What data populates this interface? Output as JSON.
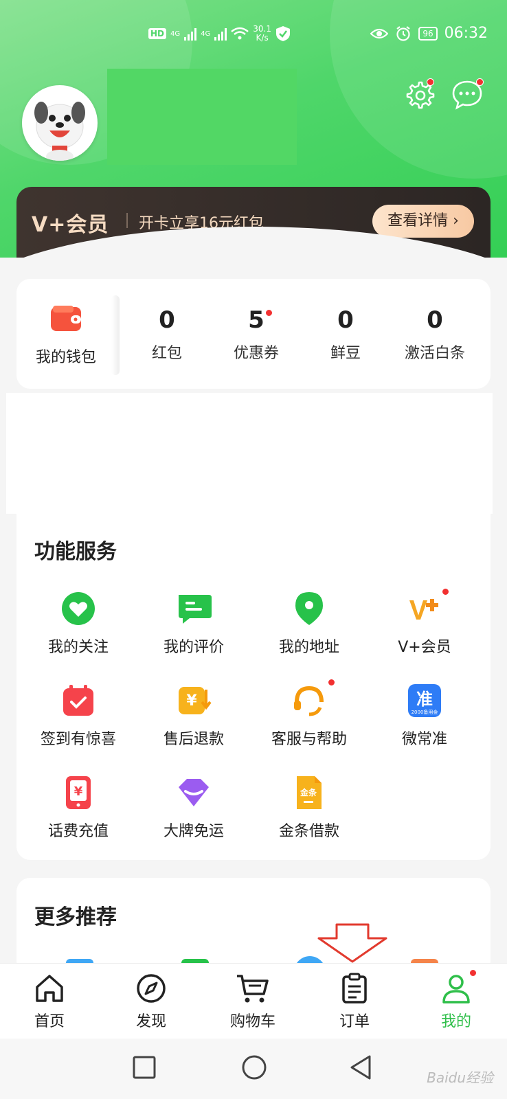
{
  "status_bar": {
    "hd": "HD",
    "network_1": "4G",
    "network_2": "4G",
    "speed_value": "30.1",
    "speed_unit": "K/s",
    "battery": "96",
    "time": "06:32"
  },
  "vip_banner": {
    "logo": "V+会员",
    "promo": "开卡立享16元红包",
    "button": "查看详情 ›"
  },
  "wallet": {
    "label": "我的钱包",
    "items": [
      {
        "value": "0",
        "label": "红包",
        "has_dot": false
      },
      {
        "value": "5",
        "label": "优惠券",
        "has_dot": true
      },
      {
        "value": "0",
        "label": "鲜豆",
        "has_dot": false
      },
      {
        "value": "0",
        "label": "激活白条",
        "has_dot": false
      }
    ]
  },
  "services": {
    "title": "功能服务",
    "items": [
      {
        "label": "我的关注",
        "icon": "heart-icon"
      },
      {
        "label": "我的评价",
        "icon": "comment-icon"
      },
      {
        "label": "我的地址",
        "icon": "location-pin-icon"
      },
      {
        "label": "V+会员",
        "icon": "vplus-icon"
      },
      {
        "label": "签到有惊喜",
        "icon": "calendar-check-icon"
      },
      {
        "label": "售后退款",
        "icon": "refund-icon"
      },
      {
        "label": "客服与帮助",
        "icon": "headset-icon"
      },
      {
        "label": "微常准",
        "icon": "weichangzhun-icon",
        "icon_text": "准",
        "icon_caption": "2000备用金"
      },
      {
        "label": "话费充值",
        "icon": "phone-recharge-icon"
      },
      {
        "label": "大牌免运",
        "icon": "diamond-box-icon"
      },
      {
        "label": "金条借款",
        "icon": "gold-bar-icon",
        "icon_text": "金条"
      }
    ]
  },
  "more": {
    "title": "更多推荐"
  },
  "bottom_nav": {
    "items": [
      {
        "label": "首页",
        "icon": "home-icon",
        "active": false
      },
      {
        "label": "发现",
        "icon": "compass-icon",
        "active": false
      },
      {
        "label": "购物车",
        "icon": "cart-icon",
        "active": false
      },
      {
        "label": "订单",
        "icon": "order-icon",
        "active": false
      },
      {
        "label": "我的",
        "icon": "profile-icon",
        "active": true
      }
    ]
  },
  "watermark": "Baidu经验",
  "colors": {
    "brand_green": "#34cf55",
    "active_green": "#2fbf4a",
    "badge_red": "#f23030",
    "vip_dark": "#3f342f",
    "vip_gold": "#f6dcc3"
  }
}
